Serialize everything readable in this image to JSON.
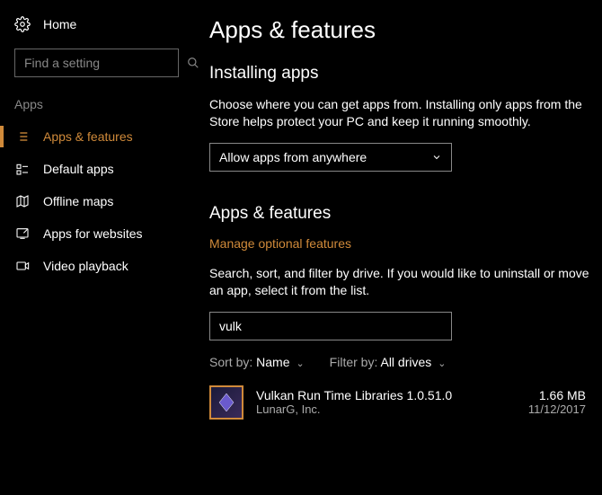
{
  "sidebar": {
    "home": "Home",
    "search_placeholder": "Find a setting",
    "category": "Apps",
    "items": [
      {
        "label": "Apps & features"
      },
      {
        "label": "Default apps"
      },
      {
        "label": "Offline maps"
      },
      {
        "label": "Apps for websites"
      },
      {
        "label": "Video playback"
      }
    ]
  },
  "main": {
    "title": "Apps & features",
    "installing_title": "Installing apps",
    "installing_desc": "Choose where you can get apps from. Installing only apps from the Store helps protect your PC and keep it running smoothly.",
    "allow_dropdown": "Allow apps from anywhere",
    "section_title": "Apps & features",
    "optional_link": "Manage optional features",
    "search_desc": "Search, sort, and filter by drive. If you would like to uninstall or move an app, select it from the list.",
    "search_value": "vulk",
    "sort_label": "Sort by:",
    "sort_value": "Name",
    "filter_label": "Filter by:",
    "filter_value": "All drives",
    "app": {
      "name": "Vulkan Run Time Libraries 1.0.51.0",
      "publisher": "LunarG, Inc.",
      "size": "1.66 MB",
      "date": "11/12/2017"
    }
  }
}
